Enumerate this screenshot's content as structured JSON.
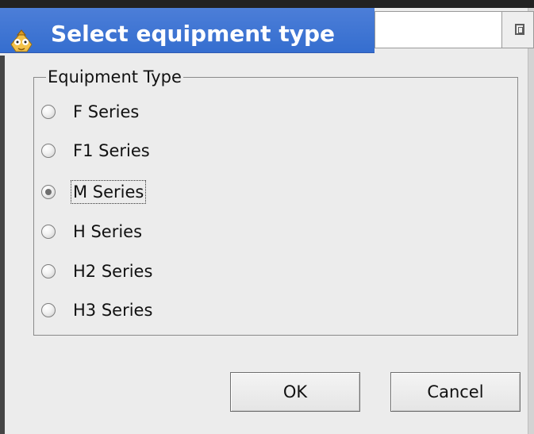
{
  "window": {
    "title": "Select equipment type",
    "title_field_value": ""
  },
  "icons": {
    "app_icon": "app-icon",
    "restore_icon": "restore-icon"
  },
  "group": {
    "label": "Equipment Type",
    "options": [
      {
        "label": "F Series",
        "checked": false
      },
      {
        "label": "F1 Series",
        "checked": false
      },
      {
        "label": "M Series",
        "checked": true
      },
      {
        "label": "H Series",
        "checked": false
      },
      {
        "label": "H2 Series",
        "checked": false
      },
      {
        "label": "H3 Series",
        "checked": false
      }
    ]
  },
  "buttons": {
    "ok_label": "OK",
    "cancel_label": "Cancel"
  },
  "colors": {
    "titlebar": "#356ecf",
    "background": "#ececec"
  }
}
